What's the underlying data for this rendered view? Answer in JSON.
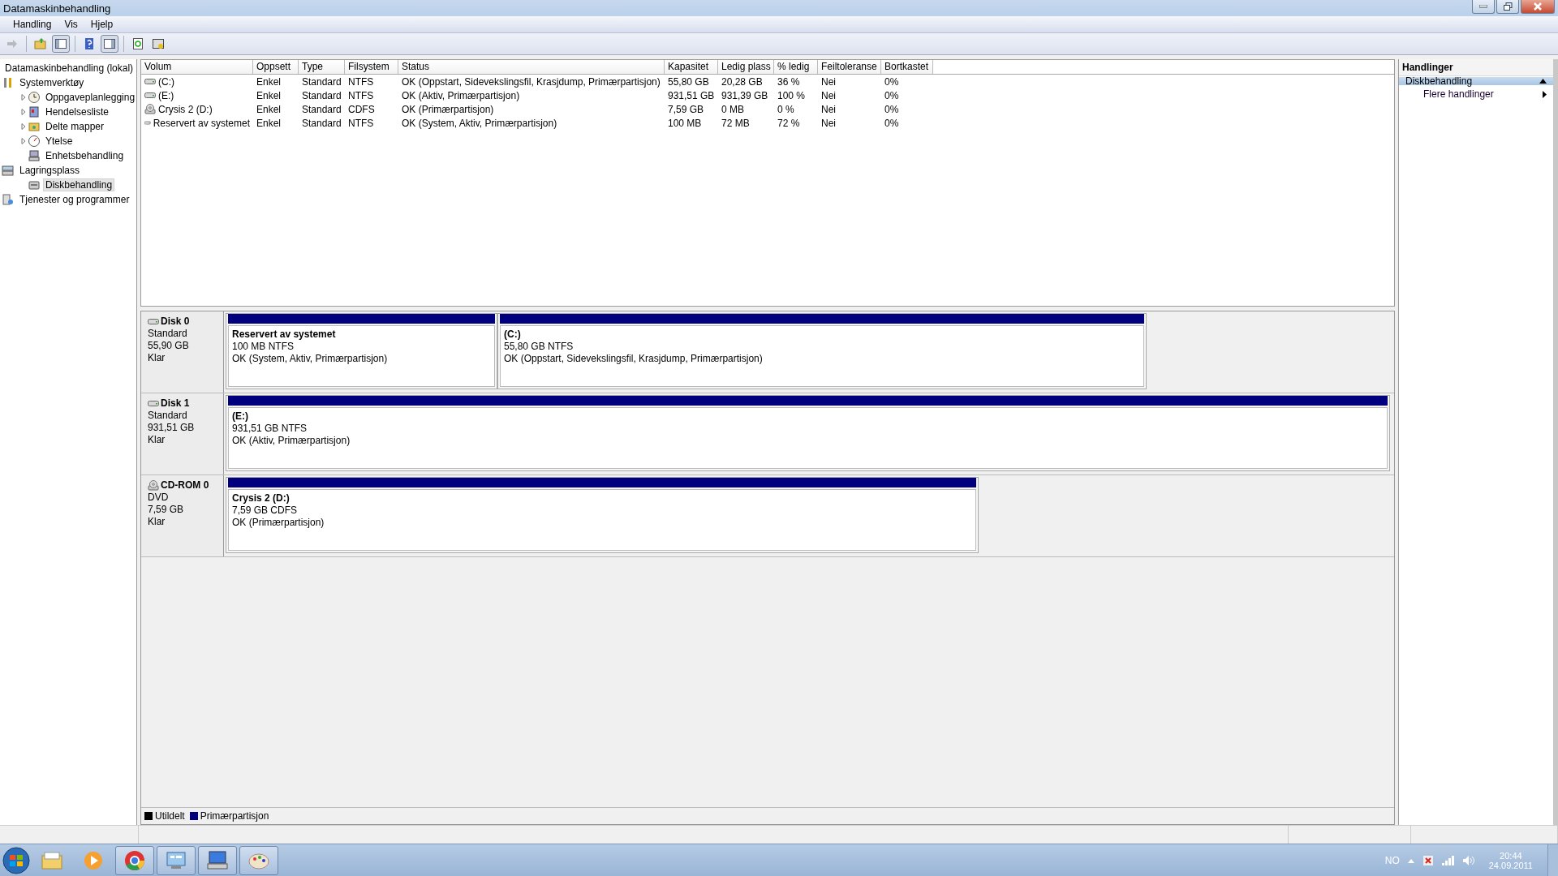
{
  "window": {
    "title": "Datamaskinbehandling"
  },
  "menu": [
    "Handling",
    "Vis",
    "Hjelp"
  ],
  "toolbar": [
    {
      "kind": "back",
      "disabled": true
    },
    {
      "kind": "up",
      "disabled": false
    },
    {
      "kind": "console-tree",
      "on": true
    },
    {
      "kind": "help",
      "disabled": false
    },
    {
      "kind": "action-pane",
      "on": true
    },
    {
      "kind": "refresh",
      "disabled": false
    },
    {
      "kind": "properties",
      "disabled": false
    }
  ],
  "tree": {
    "label": "Datamaskinbehandling (lokal)",
    "children": [
      {
        "label": "Systemverktøy",
        "selected": false,
        "children": [
          {
            "label": "Oppgaveplanlegging",
            "expanded": false,
            "selected": false
          },
          {
            "label": "Hendelsesliste",
            "expanded": false,
            "selected": false
          },
          {
            "label": "Delte mapper",
            "expanded": false,
            "selected": false
          },
          {
            "label": "Ytelse",
            "expanded": false,
            "selected": false
          },
          {
            "label": "Enhetsbehandling",
            "selected": false
          }
        ]
      },
      {
        "label": "Lagringsplass",
        "selected": false,
        "children": [
          {
            "label": "Diskbehandling",
            "selected": true
          }
        ]
      },
      {
        "label": "Tjenester og programmer",
        "selected": false
      }
    ]
  },
  "table": {
    "columns": [
      "Volum",
      "Oppsett",
      "Type",
      "Filsystem",
      "Status",
      "Kapasitet",
      "Ledig plass",
      "% ledig",
      "Feiltoleranse",
      "Bortkastet"
    ],
    "rows": [
      {
        "kind": "disk",
        "cells": [
          "(C:)",
          "Enkel",
          "Standard",
          "NTFS",
          "OK (Oppstart, Sidevekslingsfil, Krasjdump, Primærpartisjon)",
          "55,80 GB",
          "20,28 GB",
          "36 %",
          "Nei",
          "0%"
        ]
      },
      {
        "kind": "disk",
        "cells": [
          "(E:)",
          "Enkel",
          "Standard",
          "NTFS",
          "OK (Aktiv, Primærpartisjon)",
          "931,51 GB",
          "931,39 GB",
          "100 %",
          "Nei",
          "0%"
        ]
      },
      {
        "kind": "cd",
        "cells": [
          "Crysis 2 (D:)",
          "Enkel",
          "Standard",
          "CDFS",
          "OK (Primærpartisjon)",
          "7,59 GB",
          "0 MB",
          "0 %",
          "Nei",
          "0%"
        ]
      },
      {
        "kind": "disk",
        "cells": [
          "Reservert av systemet",
          "Enkel",
          "Standard",
          "NTFS",
          "OK (System, Aktiv, Primærpartisjon)",
          "100 MB",
          "72 MB",
          "72 %",
          "Nei",
          "0%"
        ]
      }
    ]
  },
  "disks": [
    {
      "kind": "disk",
      "name": "Disk 0",
      "type": "Standard",
      "size": "55,90 GB",
      "state": "Klar",
      "partitions": [
        {
          "name": "Reservert av systemet",
          "size": "100 MB NTFS",
          "status": "OK (System, Aktiv, Primærpartisjon)",
          "color": "#00007f"
        },
        {
          "name": "(C:)",
          "size": "55,80 GB NTFS",
          "status": "OK (Oppstart, Sidevekslingsfil, Krasjdump, Primærpartisjon)",
          "color": "#00007f"
        }
      ]
    },
    {
      "kind": "disk",
      "name": "Disk 1",
      "type": "Standard",
      "size": "931,51 GB",
      "state": "Klar",
      "partitions": [
        {
          "name": "(E:)",
          "size": "931,51 GB NTFS",
          "status": "OK (Aktiv, Primærpartisjon)",
          "color": "#00007f"
        }
      ]
    },
    {
      "kind": "cd",
      "name": "CD-ROM 0",
      "type": "DVD",
      "size": "7,59 GB",
      "state": "Klar",
      "partitions": [
        {
          "name": "Crysis 2  (D:)",
          "size": "7,59 GB CDFS",
          "status": "OK (Primærpartisjon)",
          "color": "#00007f"
        }
      ]
    }
  ],
  "legend": [
    {
      "label": "Utildelt",
      "color": "#000000"
    },
    {
      "label": "Primærpartisjon",
      "color": "#00007f"
    }
  ],
  "actions": {
    "title": "Handlinger",
    "section": {
      "label": "Diskbehandling",
      "expanded": true
    },
    "items": [
      "Flere handlinger"
    ]
  },
  "taskbar": {
    "apps": [
      {
        "kind": "explorer",
        "running": false
      },
      {
        "kind": "media",
        "running": false
      },
      {
        "kind": "chrome",
        "running": true
      },
      {
        "kind": "control",
        "running": true
      },
      {
        "kind": "computer",
        "running": true
      },
      {
        "kind": "paint",
        "running": true
      }
    ],
    "language": "NO",
    "time": "20:44",
    "date": "24.09.2011"
  }
}
